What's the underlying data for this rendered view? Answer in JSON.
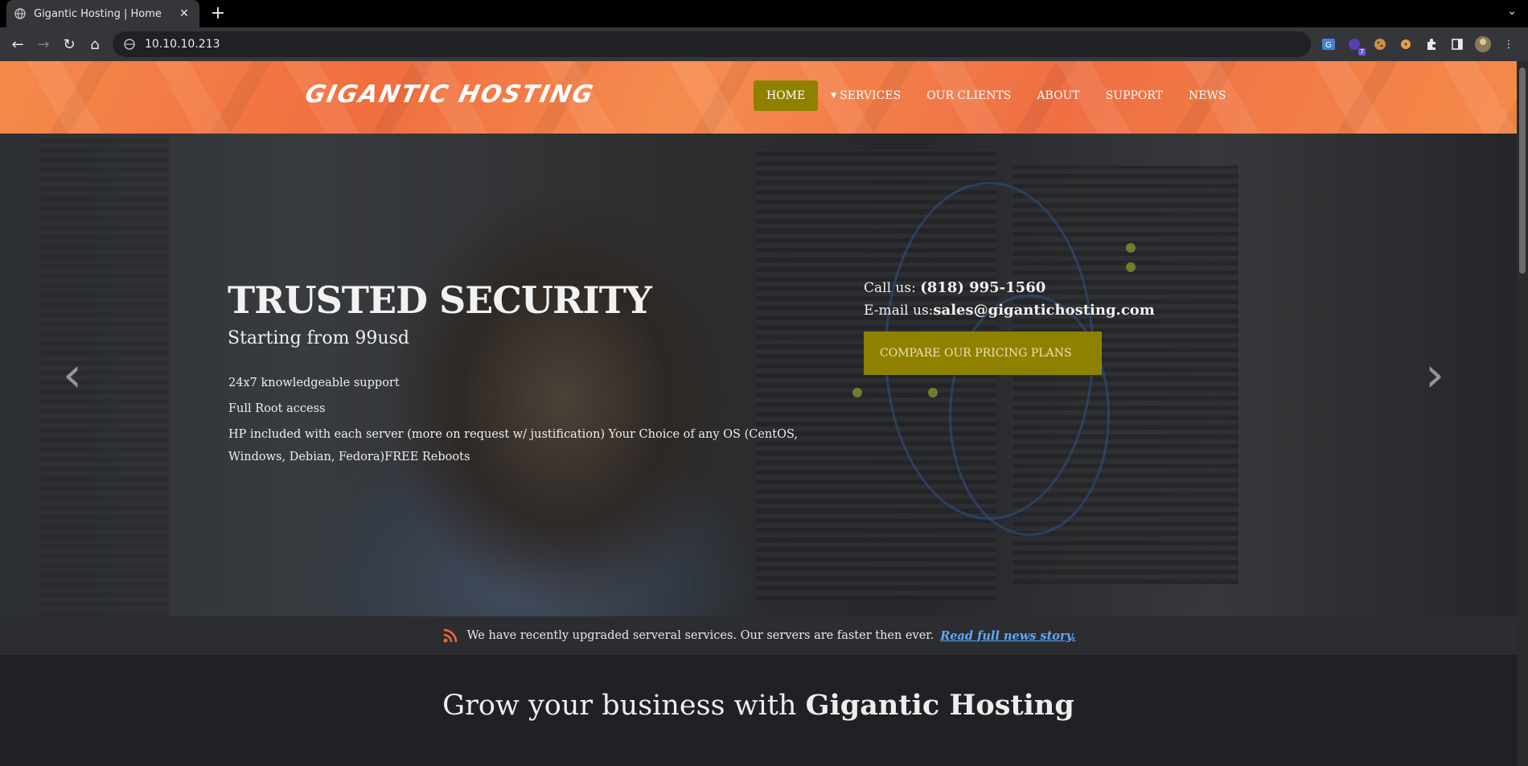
{
  "browser": {
    "tab_title": "Gigantic Hosting | Home",
    "url": "10.10.10.213",
    "extension_badge": "7"
  },
  "site": {
    "logo": "GIGANTIC HOSTING",
    "nav": [
      {
        "label": "HOME",
        "active": true
      },
      {
        "label": "SERVICES",
        "has_dropdown": true
      },
      {
        "label": "OUR CLIENTS"
      },
      {
        "label": "ABOUT"
      },
      {
        "label": "SUPPORT"
      },
      {
        "label": "NEWS"
      }
    ]
  },
  "hero": {
    "title": "TRUSTED SECURITY",
    "subtitle": "Starting from 99usd",
    "features": [
      "24x7 knowledgeable support",
      "Full Root access",
      "HP included with each server (more on request w/ justification) Your Choice of any OS (CentOS, Windows, Debian, Fedora)FREE Reboots"
    ],
    "call_label": "Call us:",
    "phone": "(818) 995-1560",
    "email_label": "E-mail us:",
    "email": "sales@gigantichosting.com",
    "cta": "COMPARE OUR PRICING PLANS",
    "prev_arrow": "‹",
    "next_arrow": "›"
  },
  "news": {
    "text": "We have recently upgraded serveral services. Our servers are faster then ever.",
    "link": "Read full news story."
  },
  "grow": {
    "prefix": "Grow your business with",
    "brand": "Gigantic Hosting"
  },
  "colors": {
    "header_orange": "#f27a45",
    "accent_olive": "#8f8100",
    "link_blue": "#5fa8ff"
  }
}
